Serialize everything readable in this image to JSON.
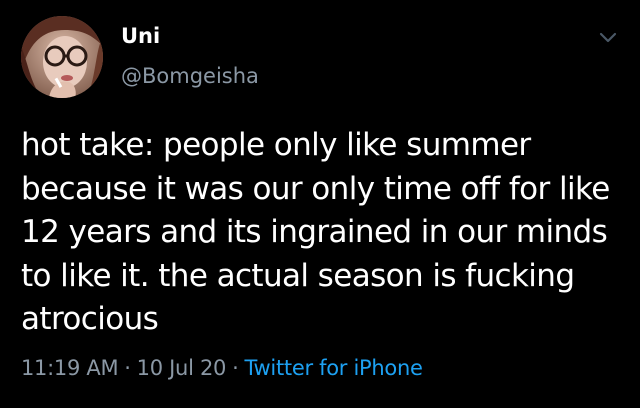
{
  "author": {
    "display_name": "Uni",
    "handle": "@Bomgeisha"
  },
  "tweet": {
    "text": "hot take: people only like summer because it was our only time off for like 12 years and its ingrained in our minds to like it. the actual season is fucking atrocious",
    "time": "11:19 AM",
    "date": "10 Jul 20",
    "separator": "·",
    "source": "Twitter for iPhone"
  },
  "icons": {
    "avatar": "avatar-photo",
    "menu": "chevron-down-icon"
  },
  "colors": {
    "background": "#000000",
    "primary_text": "#ffffff",
    "secondary_text": "#8b98a5",
    "link": "#1da1f2"
  }
}
